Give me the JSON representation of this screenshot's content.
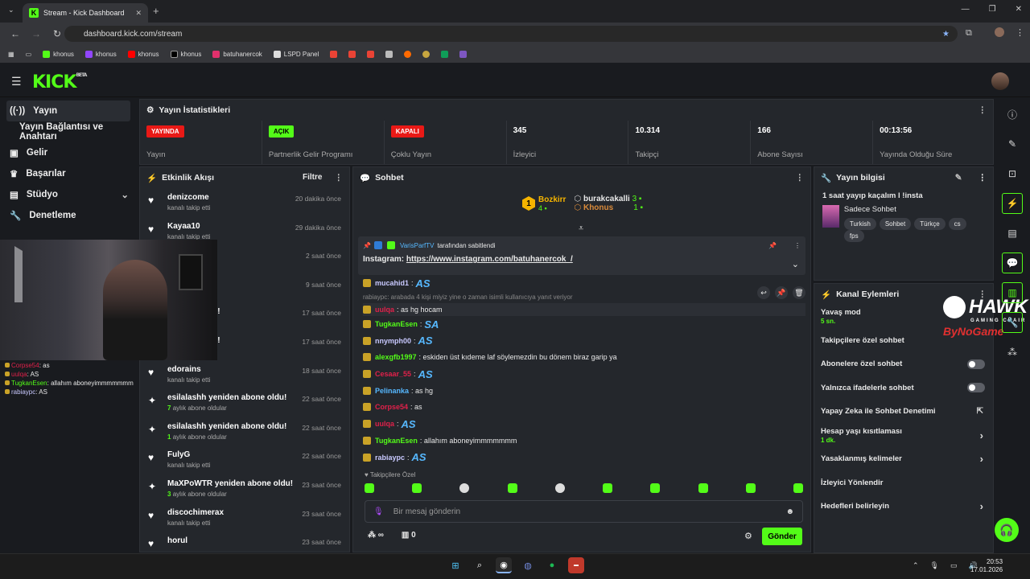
{
  "browser": {
    "tab_title": "Stream - Kick Dashboard",
    "url": "dashboard.kick.com/stream",
    "bookmarks": [
      "khonus",
      "khonus",
      "khonus",
      "khonus",
      "batuhanercok",
      "LSPD Panel"
    ]
  },
  "app": {
    "logo": "KICK",
    "logo_badge": "BETA"
  },
  "sidebar": {
    "items": [
      {
        "label": "Yayın",
        "icon": "broadcast-icon"
      },
      {
        "label": "Yayın Bağlantısı ve Anahtarı",
        "icon": "key-icon"
      },
      {
        "label": "Gelir",
        "icon": "wallet-icon"
      },
      {
        "label": "Başarılar",
        "icon": "trophy-icon"
      },
      {
        "label": "Stüdyo",
        "icon": "studio-icon"
      },
      {
        "label": "Denetleme",
        "icon": "wrench-icon"
      }
    ]
  },
  "overlay_chat": [
    {
      "user": "Corpse54",
      "text": ": as",
      "color": "#e0204a"
    },
    {
      "user": "uulqa",
      "text": ": AS",
      "color": "#e0204a"
    },
    {
      "user": "TugkanEsen",
      "text": ": allahım aboneyimmmmmmm",
      "color": "#53fc18"
    },
    {
      "user": "rabiaypc",
      "text": ": AS",
      "color": "#c9c9ff"
    }
  ],
  "stats": {
    "title": "Yayın İstatistikleri",
    "cells": [
      {
        "badge": "YAYINDA",
        "label": "Yayın"
      },
      {
        "badge": "AÇIK",
        "label": "Partnerlik Gelir Programı"
      },
      {
        "badge": "KAPALI",
        "label": "Çoklu Yayın"
      },
      {
        "value": "345",
        "label": "İzleyici"
      },
      {
        "value": "10.314",
        "label": "Takipçi"
      },
      {
        "value": "166",
        "label": "Abone Sayısı"
      },
      {
        "value": "00:13:56",
        "label": "Yayında Olduğu Süre"
      }
    ]
  },
  "activity": {
    "title": "Etkinlik Akışı",
    "filter": "Filtre",
    "items": [
      {
        "name": "denizcome",
        "sub": "kanalı takip etti",
        "time": "20 dakika önce",
        "icon": "heart"
      },
      {
        "name": "Kayaa10",
        "sub": "kanalı takip etti",
        "time": "29 dakika önce",
        "icon": "heart"
      },
      {
        "name": "m",
        "sub": "",
        "time": "2 saat önce",
        "icon": "heart"
      },
      {
        "name": "",
        "sub": "",
        "time": "9 saat önce",
        "icon": "heart"
      },
      {
        "name": "n abone oldu!",
        "sub": "",
        "time": "17 saat önce",
        "icon": "star"
      },
      {
        "name": "n abone oldu!",
        "sub": "",
        "time": "17 saat önce",
        "icon": "star"
      },
      {
        "name": "edorains",
        "sub": "kanalı takip etti",
        "time": "18 saat önce",
        "icon": "heart"
      },
      {
        "name": "esilalashh yeniden abone oldu!",
        "sub_num": "7",
        "sub": "aylık abone oldular",
        "time": "22 saat önce",
        "icon": "star"
      },
      {
        "name": "esilalashh yeniden abone oldu!",
        "sub_num": "1",
        "sub": "aylık abone oldular",
        "time": "22 saat önce",
        "icon": "star"
      },
      {
        "name": "FulyG",
        "sub": "kanalı takip etti",
        "time": "22 saat önce",
        "icon": "heart"
      },
      {
        "name": "MaXPoWTR yeniden abone oldu!",
        "sub_num": "3",
        "sub": "aylık abone oldular",
        "time": "23 saat önce",
        "icon": "star"
      },
      {
        "name": "discochimerax",
        "sub": "kanalı takip etti",
        "time": "23 saat önce",
        "icon": "heart"
      },
      {
        "name": "horul",
        "sub": "",
        "time": "23 saat önce",
        "icon": "heart"
      }
    ]
  },
  "chat": {
    "title": "Sohbet",
    "leaderboard": [
      {
        "name": "Bozkirr",
        "count": "4",
        "rank": "1"
      },
      {
        "name": "burakcakalli",
        "count": "3"
      },
      {
        "name": "Khonus",
        "count": "1"
      }
    ],
    "pinned": {
      "by_user": "VarisParfTV",
      "by_text": "tarafından sabitlendi",
      "label": "Instagram:",
      "link": "https://www.instagram.com/batuhanercok_/"
    },
    "messages": [
      {
        "user": "mucahid1",
        "text": ":",
        "emote": "AS",
        "color": "#c9c9ff"
      },
      {
        "reply": "rabiaypc: arabada 4 kişi miyiz yine o zaman isimli kullanıcıya yanıt veriyor",
        "user": "uulqa",
        "text": ": as hg hocam",
        "color": "#e0204a"
      },
      {
        "user": "TugkanEsen",
        "text": ":",
        "emote": "SA",
        "color": "#53fc18"
      },
      {
        "user": "nnymph00",
        "text": ":",
        "emote": "AS",
        "color": "#c9c9ff"
      },
      {
        "user": "alexgfb1997",
        "text": ": eskiden üst kıdeme laf söylemezdin bu dönem biraz garip ya",
        "color": "#53fc18"
      },
      {
        "user": "Cesaar_55",
        "text": ":",
        "emote": "AS",
        "color": "#e0204a"
      },
      {
        "user": "Pelinanka",
        "text": ": as hg",
        "color": "#56b8ff"
      },
      {
        "user": "Corpse54",
        "text": ": as",
        "color": "#e0204a"
      },
      {
        "user": "uulqa",
        "text": ":",
        "emote": "AS",
        "color": "#e0204a"
      },
      {
        "user": "TugkanEsen",
        "text": ": allahım aboneyimmmmmmm",
        "color": "#53fc18"
      },
      {
        "user": "rabiaypc",
        "text": ":",
        "emote": "AS",
        "color": "#c9c9ff"
      }
    ],
    "followers_only": "Takipçilere Özel",
    "input_placeholder": "Bir mesaj gönderin",
    "infinity_count": "∞",
    "gift_count": "0",
    "send_label": "Gönder"
  },
  "stream_info": {
    "title": "Yayın bilgisi",
    "stream_title": "1 saat yayıp kaçalım l !insta",
    "category": "Sadece Sohbet",
    "tags": [
      "Turkish",
      "Sohbet",
      "Türkçe",
      "cs",
      "fps"
    ]
  },
  "channel_actions": {
    "title": "Kanal Eylemleri",
    "rows": [
      {
        "label": "Yavaş mod",
        "sub": "5 sn.",
        "control": "none"
      },
      {
        "label": "Takipçilere özel sohbet",
        "control": "none"
      },
      {
        "label": "Abonelere özel sohbet",
        "control": "toggle"
      },
      {
        "label": "Yalnızca ifadelerle sohbet",
        "control": "toggle"
      },
      {
        "label": "Yapay Zeka ile Sohbet Denetimi",
        "control": "external"
      },
      {
        "label": "Hesap yaşı kısıtlaması",
        "sub": "1 dk.",
        "control": "chevron"
      },
      {
        "label": "Yasaklanmış kelimeler",
        "control": "chevron"
      },
      {
        "label": "İzleyici Yönlendir",
        "control": "none"
      },
      {
        "label": "Hedefleri belirleyin",
        "control": "chevron"
      }
    ]
  },
  "overlay_logo": {
    "main": "HAWK",
    "sub": "GAMING CHAIR",
    "partner": "ByNoGame"
  },
  "taskbar": {
    "time": "20:53",
    "date": "17.01.2026"
  },
  "colors": {
    "accent": "#53fc18",
    "live": "#e91916",
    "panel": "#24272c",
    "bg": "#191b1f"
  }
}
